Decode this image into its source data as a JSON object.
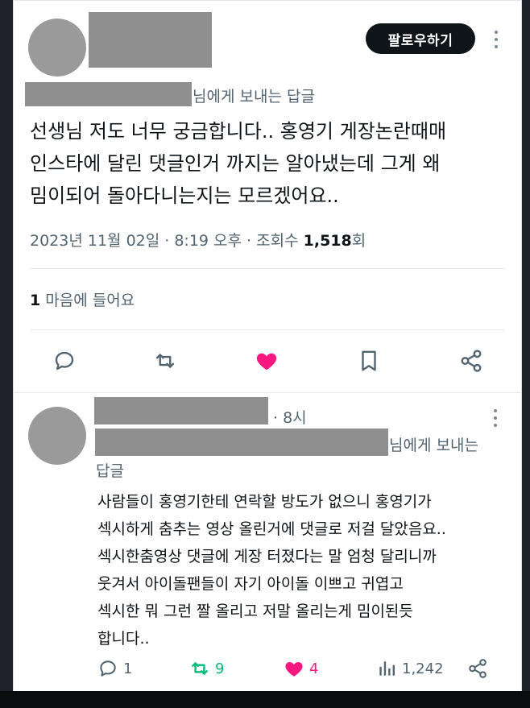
{
  "tweet": {
    "reply_to_suffix": "님에게 보내는 답글",
    "follow_label": "팔로우하기",
    "lines": [
      "선생님 저도 너무 궁금합니다.. 홍영기 게장논란때매",
      "인스타에 달린 댓글인거 까지는 알아냈는데 그게 왜",
      "밈이되어 돌아다니는지는 모르겠어요.."
    ],
    "meta_prefix": "2023년 11월 02일 · 8:19 오후 · 조회수 ",
    "views": "1,518",
    "views_unit": "회",
    "likes_count": "1",
    "likes_label": " 마음에 들어요",
    "icons": [
      "reply-icon",
      "retweet-icon",
      "like-icon",
      "bookmark-icon",
      "share-icon"
    ],
    "like_color": "#f91880"
  },
  "reply": {
    "time": "· 8시",
    "reply_to_suffix": "님에게 보내는",
    "reply_to_suffix_2": "답글",
    "lines": [
      "사람들이 홍영기한테 연락할 방도가 없으니 홍영기가",
      "섹시하게 춤추는 영상 올린거에 댓글로 저걸 달았음요..",
      "섹시한춤영상 댓글에 게장 터졌다는 말 엄청 달리니까",
      "웃겨서 아이돌팬들이 자기 아이돌 이쁘고 귀엽고",
      "섹시한 뭐 그런 짤 올리고 저말 올리는게 밈이된듯",
      "합니다.."
    ],
    "stats": {
      "replies": "1",
      "retweets": "9",
      "likes": "4",
      "views": "1,242"
    },
    "retweet_color": "#00ba7c",
    "like_color": "#f91880"
  }
}
